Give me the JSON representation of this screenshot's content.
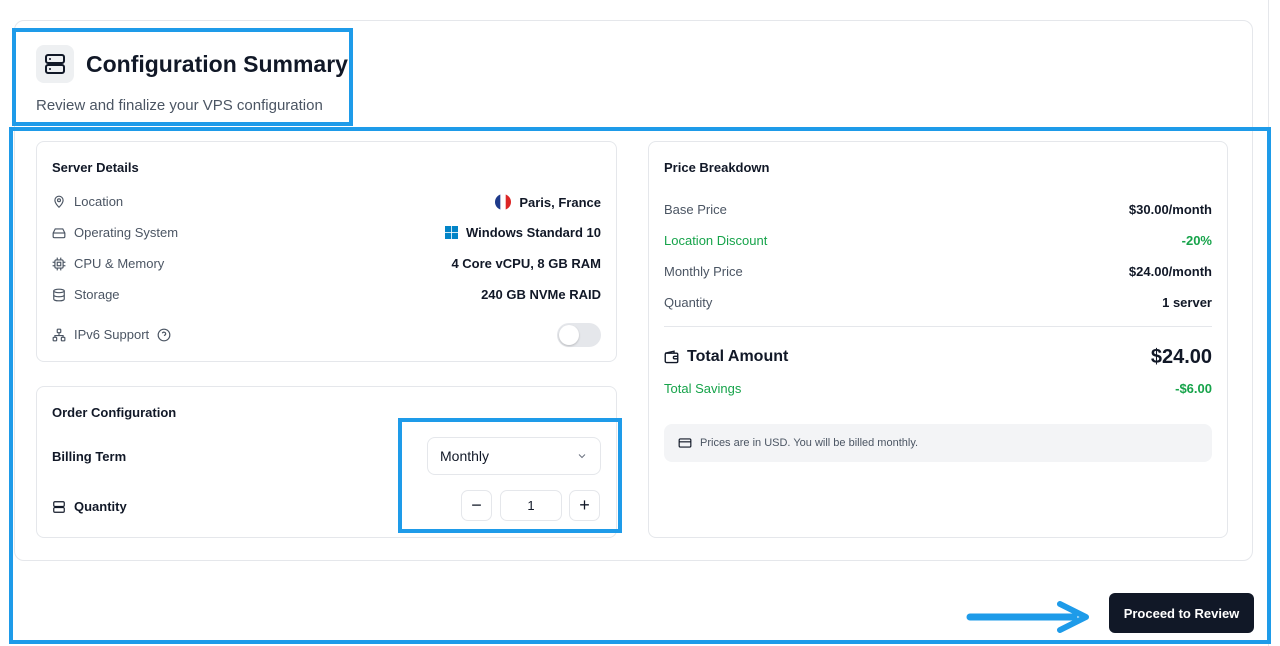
{
  "header": {
    "title": "Configuration Summary",
    "subtitle": "Review and finalize your VPS configuration"
  },
  "server_details": {
    "title": "Server Details",
    "rows": [
      {
        "label": "Location",
        "icon": "map-pin-icon",
        "value": "Paris, France",
        "value_icon": "france-flag-icon"
      },
      {
        "label": "Operating System",
        "icon": "hard-drive-icon",
        "value": "Windows Standard 10",
        "value_icon": "windows-logo-icon"
      },
      {
        "label": "CPU & Memory",
        "icon": "cpu-icon",
        "value": "4 Core vCPU, 8 GB RAM"
      },
      {
        "label": "Storage",
        "icon": "database-icon",
        "value": "240 GB NVMe RAID"
      }
    ],
    "ipv6": {
      "label": "IPv6 Support",
      "enabled": false
    }
  },
  "order_configuration": {
    "title": "Order Configuration",
    "billing_term_label": "Billing Term",
    "billing_term_value": "Monthly",
    "quantity_label": "Quantity",
    "quantity_value": "1",
    "minus": "−",
    "plus": "+"
  },
  "price_breakdown": {
    "title": "Price Breakdown",
    "base_price_label": "Base Price",
    "base_price_value": "$30.00/month",
    "location_discount_label": "Location Discount",
    "location_discount_value": "-20%",
    "monthly_price_label": "Monthly Price",
    "monthly_price_value": "$24.00/month",
    "quantity_label": "Quantity",
    "quantity_value": "1 server",
    "total_label": "Total Amount",
    "total_value": "$24.00",
    "savings_label": "Total Savings",
    "savings_value": "-$6.00",
    "note": "Prices are in USD. You will be billed monthly."
  },
  "actions": {
    "proceed_label": "Proceed to Review"
  },
  "colors": {
    "highlight": "#1e9be9",
    "green": "#16a34a",
    "button_bg": "#111827"
  }
}
